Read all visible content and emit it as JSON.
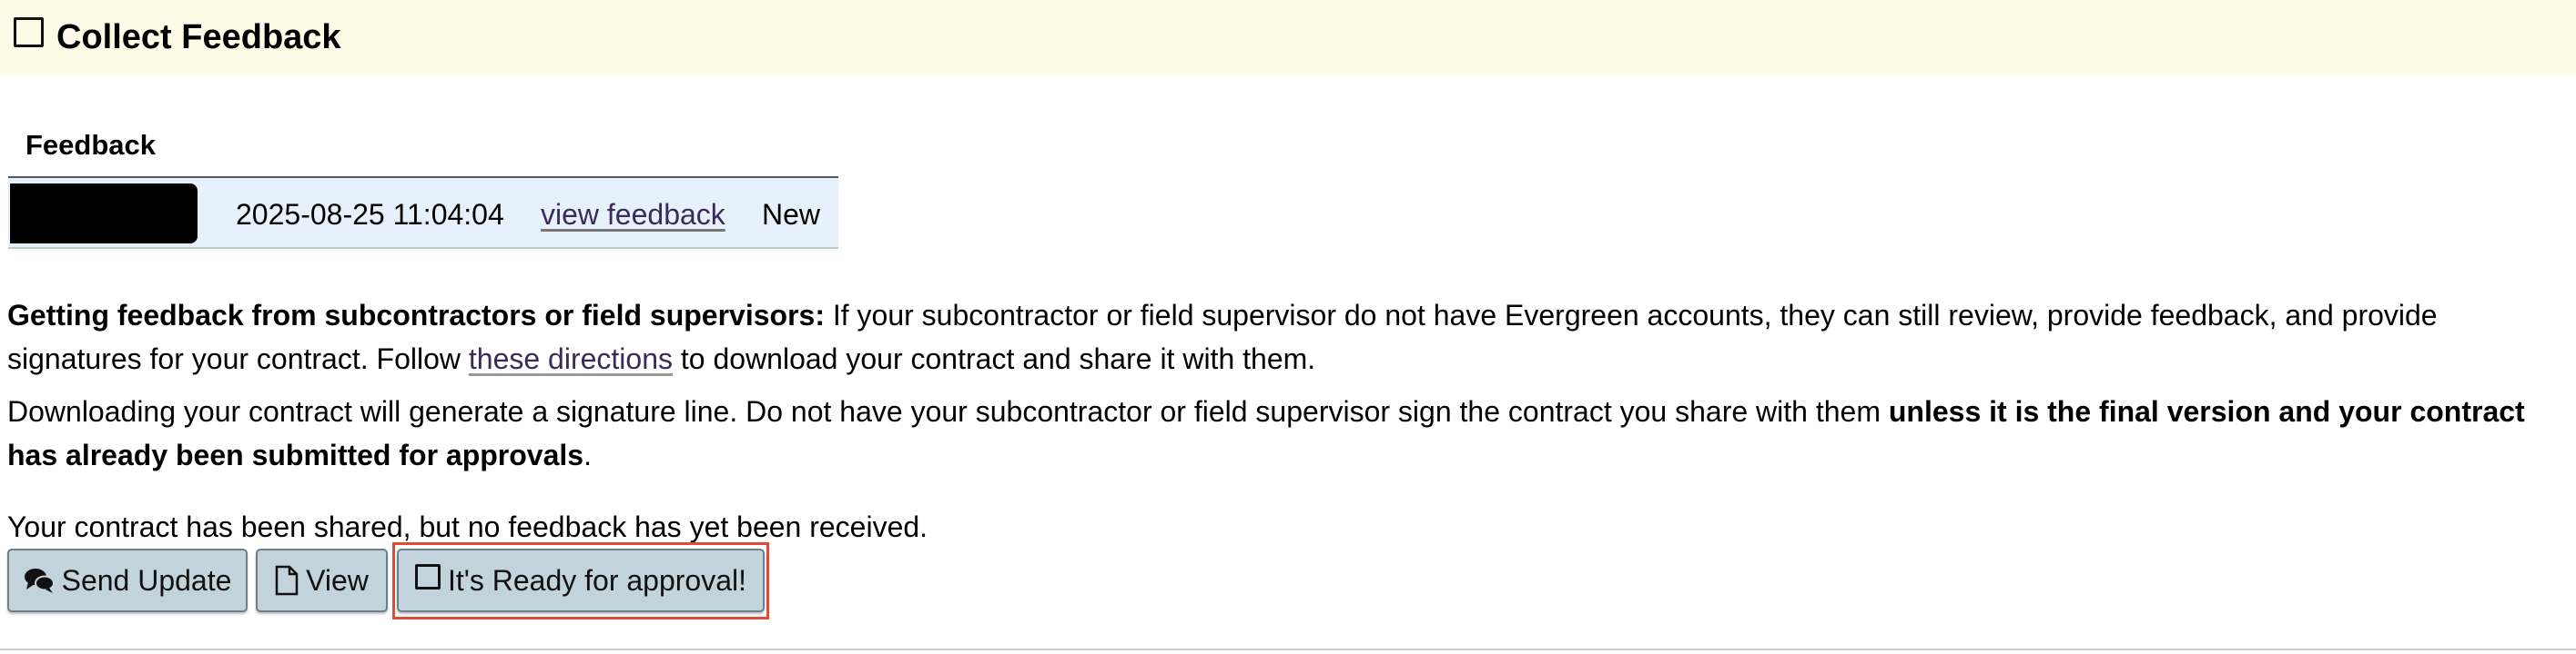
{
  "section": {
    "title": "Collect Feedback"
  },
  "feedback": {
    "heading": "Feedback",
    "rows": [
      {
        "date": "2025-08-25 11:04:04",
        "link": "view feedback",
        "status": "New"
      }
    ]
  },
  "info": {
    "p1_bold": "Getting feedback from subcontractors or field supervisors:",
    "p1_text": " If your subcontractor or field supervisor do not have Evergreen accounts, they can still review, provide feedback, and provide signatures for your contract. Follow ",
    "p1_link": "these directions",
    "p1_end": " to download your contract and share it with them.",
    "p2_text": "Downloading your contract will generate a signature line. Do not have your subcontractor or field supervisor sign the contract you share with them ",
    "p2_bold": "unless it is the final version and your contract has already been submitted for approvals",
    "p2_end": ".",
    "status": "Your contract has been shared, but no feedback has yet been received."
  },
  "buttons": {
    "send_update": "Send Update",
    "view": "View",
    "ready": "It's Ready for approval!"
  },
  "icons": {
    "header": "checkbox-icon",
    "send_update": "chat-bubbles-icon",
    "view": "document-icon",
    "ready": "checkbox-icon"
  },
  "colors": {
    "header_bg": "#fdfbe6",
    "table_bg": "#e7f1fb",
    "button_bg": "#c3d3dc",
    "highlight": "#e14a36",
    "link": "#3b2a5a"
  }
}
